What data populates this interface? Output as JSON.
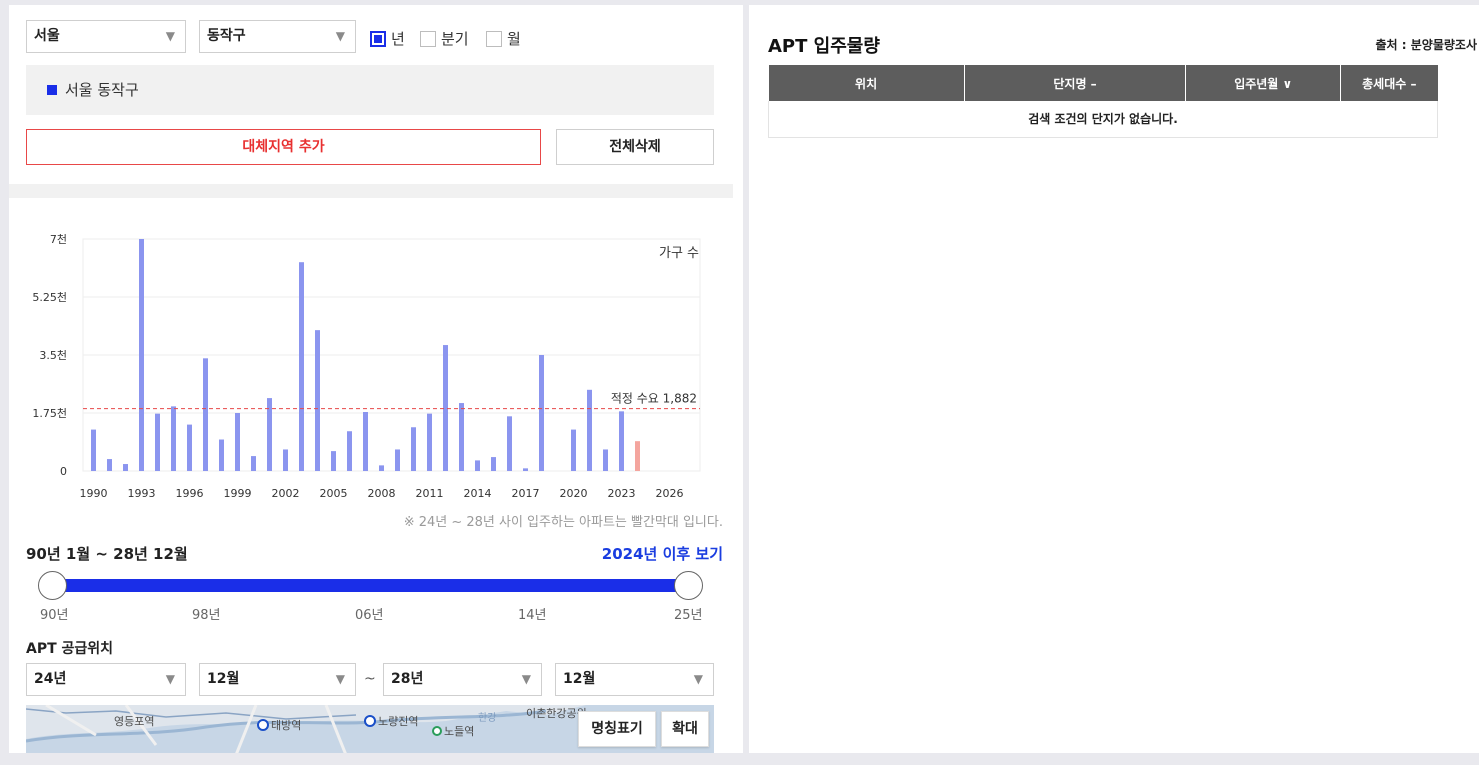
{
  "filters": {
    "city": "서울",
    "district": "동작구",
    "period_options": [
      {
        "label": "년",
        "checked": true
      },
      {
        "label": "분기",
        "checked": false
      },
      {
        "label": "월",
        "checked": false
      }
    ]
  },
  "region_bar": {
    "label": "서울 동작구"
  },
  "buttons": {
    "add_region": "대체지역 추가",
    "clear_all": "전체삭제"
  },
  "chart_data": {
    "type": "bar",
    "legend_label": "가구 수",
    "y_ticks": [
      "7천",
      "5.25천",
      "3.5천",
      "1.75천",
      "0"
    ],
    "ylim": [
      0,
      7000
    ],
    "x_ticks": [
      "1990",
      "1993",
      "1996",
      "1999",
      "2002",
      "2005",
      "2008",
      "2011",
      "2014",
      "2017",
      "2020",
      "2023",
      "2026"
    ],
    "categories": [
      1990,
      1991,
      1992,
      1993,
      1994,
      1995,
      1996,
      1997,
      1998,
      1999,
      2000,
      2001,
      2002,
      2003,
      2004,
      2005,
      2006,
      2007,
      2008,
      2009,
      2010,
      2011,
      2012,
      2013,
      2014,
      2015,
      2016,
      2017,
      2018,
      2019,
      2020,
      2021,
      2022,
      2023,
      2024,
      2025,
      2026,
      2027,
      2028
    ],
    "series": [
      {
        "values": [
          1250,
          360,
          210,
          7000,
          1730,
          1950,
          1400,
          3400,
          950,
          1750,
          450,
          2200,
          650,
          6300,
          4250,
          600,
          1200,
          1780,
          170,
          650,
          1320,
          1730,
          3800,
          2050,
          320,
          420,
          1650,
          80,
          3500,
          0,
          1250,
          2450,
          650,
          1800,
          900,
          0,
          0,
          0,
          0
        ]
      }
    ],
    "future_from": 2024,
    "reference_line": {
      "value": 1882,
      "label": "적정 수요 1,882"
    },
    "colors": {
      "past": "#8b95ef",
      "future": "#f4a59e",
      "line": "#e84848"
    }
  },
  "note": "※ 24년 ~ 28년 사이 입주하는 아파트는 빨간막대 입니다.",
  "period_range": {
    "label": "90년 1월 ~ 28년 12월",
    "link": "2024년 이후 보기"
  },
  "slider": {
    "ticks": [
      "90년",
      "98년",
      "06년",
      "14년",
      "25년"
    ],
    "start_fraction": 0,
    "end_fraction": 1
  },
  "supply": {
    "title": "APT 공급위치",
    "from_year": "24년",
    "from_month": "12월",
    "to_year": "28년",
    "to_month": "12월",
    "tilde": "~"
  },
  "map": {
    "labels": [
      "영등포역",
      "태방역",
      "노량진역",
      "노들역",
      "이촌한강공원",
      "한강"
    ],
    "buttons": {
      "names": "명칭표기",
      "zoom": "확대"
    }
  },
  "right": {
    "title": "APT 입주물량",
    "source": "출처 : 분양물량조사",
    "table": {
      "headers": [
        "위치",
        "단지명 –",
        "입주년월 ∨",
        "총세대수 –"
      ],
      "empty": "검색 조건의 단지가 없습니다."
    }
  }
}
